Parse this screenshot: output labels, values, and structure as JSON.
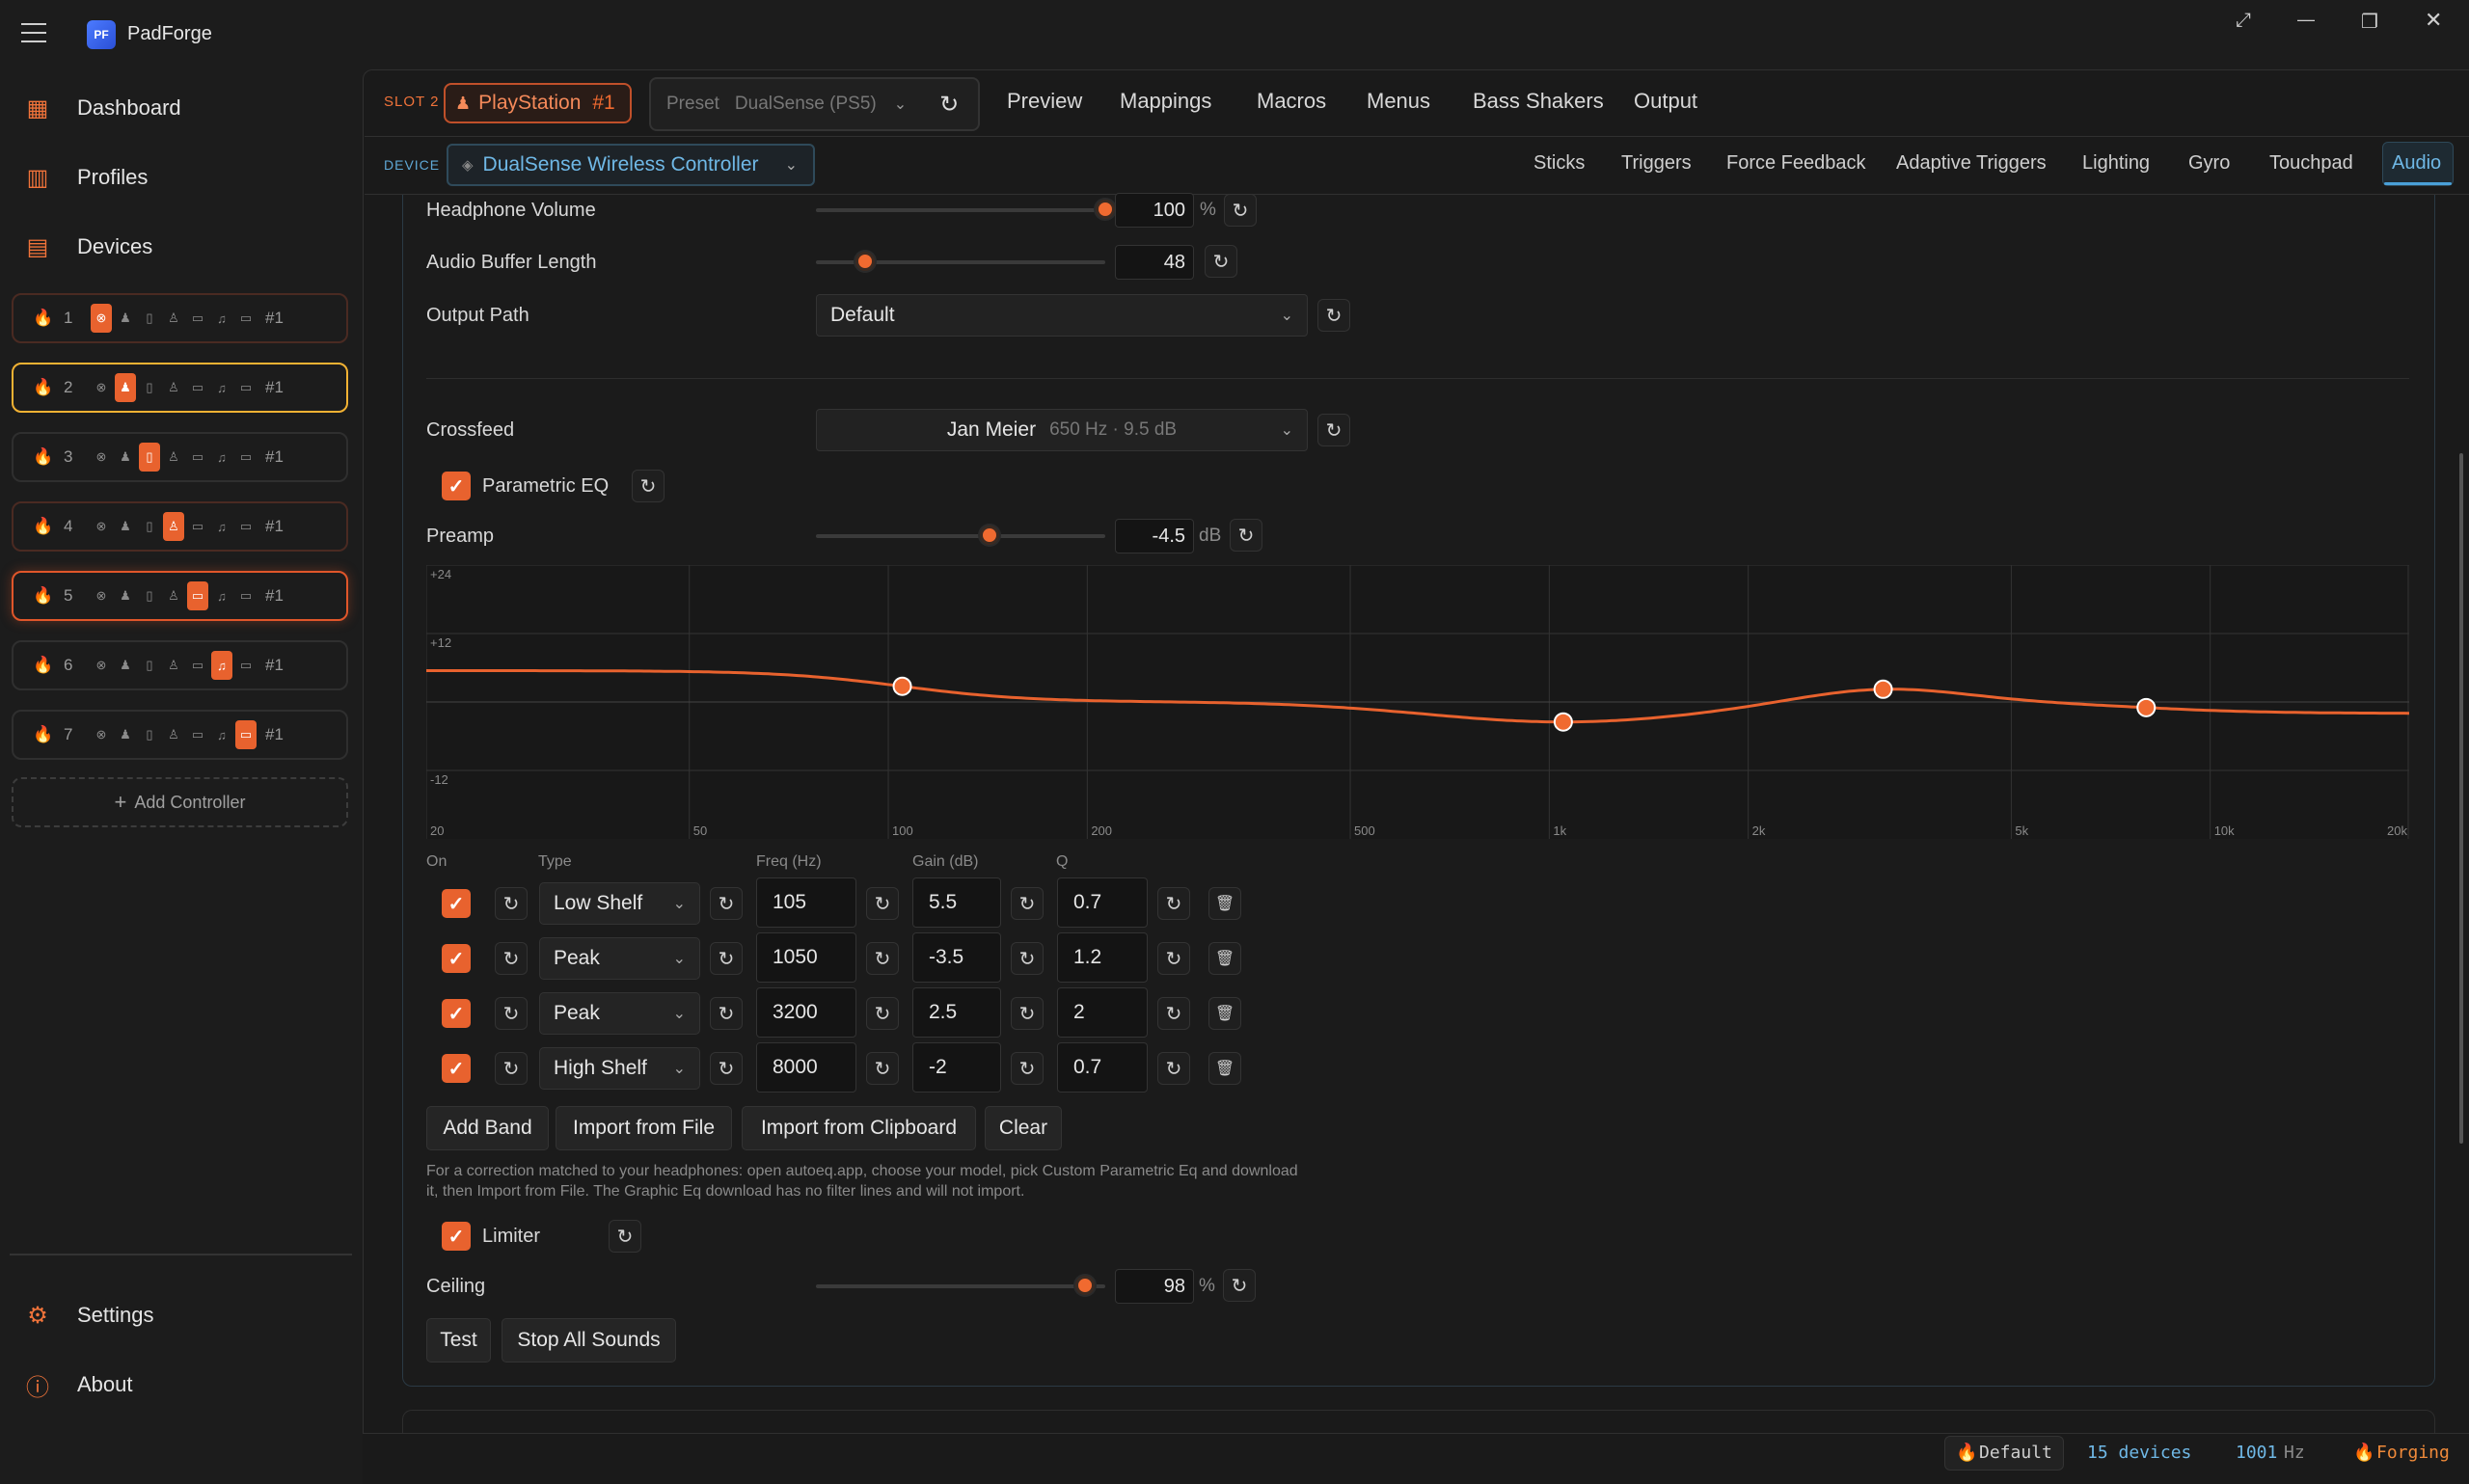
{
  "app": {
    "name": "PadForge",
    "logo_text": "PF"
  },
  "window_controls": {
    "expand": "⤢",
    "minimize": "—",
    "restore": "❐",
    "close": "✕"
  },
  "sidebar": {
    "nav": [
      {
        "label": "Dashboard",
        "icon": "dashboard-icon"
      },
      {
        "label": "Profiles",
        "icon": "profiles-icon"
      },
      {
        "label": "Devices",
        "icon": "devices-icon"
      }
    ],
    "slots": [
      {
        "num": "1",
        "tag": "#1",
        "active_index": 0,
        "lit": true
      },
      {
        "num": "2",
        "tag": "#1",
        "active_index": 1,
        "lit": true
      },
      {
        "num": "3",
        "tag": "#1",
        "active_index": 2,
        "lit": false
      },
      {
        "num": "4",
        "tag": "#1",
        "active_index": 3,
        "lit": true
      },
      {
        "num": "5",
        "tag": "#1",
        "active_index": 4,
        "lit": true
      },
      {
        "num": "6",
        "tag": "#1",
        "active_index": 5,
        "lit": false
      },
      {
        "num": "7",
        "tag": "#1",
        "active_index": 6,
        "lit": false
      }
    ],
    "add_controller": "Add Controller",
    "footer": [
      {
        "label": "Settings",
        "icon": "gear-icon"
      },
      {
        "label": "About",
        "icon": "info-icon"
      }
    ]
  },
  "topbar": {
    "slot_label": "SLOT 2",
    "controller_type": "PlayStation",
    "controller_num": "#1",
    "preset_label": "Preset",
    "preset_value": "DualSense (PS5)",
    "tabs": [
      "Preview",
      "Mappings",
      "Macros",
      "Menus",
      "Bass Shakers",
      "Output"
    ]
  },
  "devicebar": {
    "label": "DEVICE",
    "device": "DualSense Wireless Controller",
    "tabs": [
      "Sticks",
      "Triggers",
      "Force Feedback",
      "Adaptive Triggers",
      "Lighting",
      "Gyro",
      "Touchpad",
      "Audio"
    ],
    "active_tab": "Audio"
  },
  "audio": {
    "headphone_volume": {
      "label": "Headphone Volume",
      "value": "100",
      "unit": "%",
      "fraction": 1.0
    },
    "buffer_length": {
      "label": "Audio Buffer Length",
      "value": "48",
      "fraction": 0.17
    },
    "output_path": {
      "label": "Output Path",
      "value": "Default"
    },
    "crossfeed": {
      "label": "Crossfeed",
      "value": "Jan Meier",
      "detail": "650 Hz · 9.5 dB"
    },
    "parametric_eq": {
      "label": "Parametric EQ",
      "checked": true
    },
    "preamp": {
      "label": "Preamp",
      "value": "-4.5",
      "unit": "dB",
      "fraction": 0.6
    },
    "limiter": {
      "label": "Limiter",
      "checked": true
    },
    "ceiling": {
      "label": "Ceiling",
      "value": "98",
      "unit": "%",
      "fraction": 0.93
    }
  },
  "eq_graph": {
    "y_ticks": [
      "+24",
      "+12",
      "-12"
    ],
    "x_ticks": [
      "20",
      "50",
      "100",
      "200",
      "500",
      "1k",
      "2k",
      "5k",
      "10k",
      "20k"
    ],
    "y_range": [
      -24,
      24
    ],
    "x_range_hz": [
      20,
      20000
    ]
  },
  "bands_header": {
    "on": "On",
    "type": "Type",
    "freq": "Freq (Hz)",
    "gain": "Gain (dB)",
    "q": "Q"
  },
  "bands": [
    {
      "on": true,
      "type": "Low Shelf",
      "freq": "105",
      "gain": "5.5",
      "q": "0.7"
    },
    {
      "on": true,
      "type": "Peak",
      "freq": "1050",
      "gain": "-3.5",
      "q": "1.2"
    },
    {
      "on": true,
      "type": "Peak",
      "freq": "3200",
      "gain": "2.5",
      "q": "2"
    },
    {
      "on": true,
      "type": "High Shelf",
      "freq": "8000",
      "gain": "-2",
      "q": "0.7"
    }
  ],
  "eq_buttons": [
    "Add Band",
    "Import from File",
    "Import from Clipboard",
    "Clear"
  ],
  "help_text_1": "For a correction matched to your headphones: open autoeq.app, choose your model, pick Custom Parametric Eq and download",
  "help_text_2": "it, then Import from File. The Graphic Eq download has no filter lines and will not import.",
  "test_buttons": [
    "Test",
    "Stop All Sounds"
  ],
  "statusbar": {
    "profile": "Default",
    "devices": "15 devices",
    "rate": "1001",
    "rate_unit": "Hz",
    "state": "Forging"
  },
  "colors": {
    "accent": "#e8622e",
    "blue": "#6fb8e6",
    "bg": "#1c1c1c"
  }
}
